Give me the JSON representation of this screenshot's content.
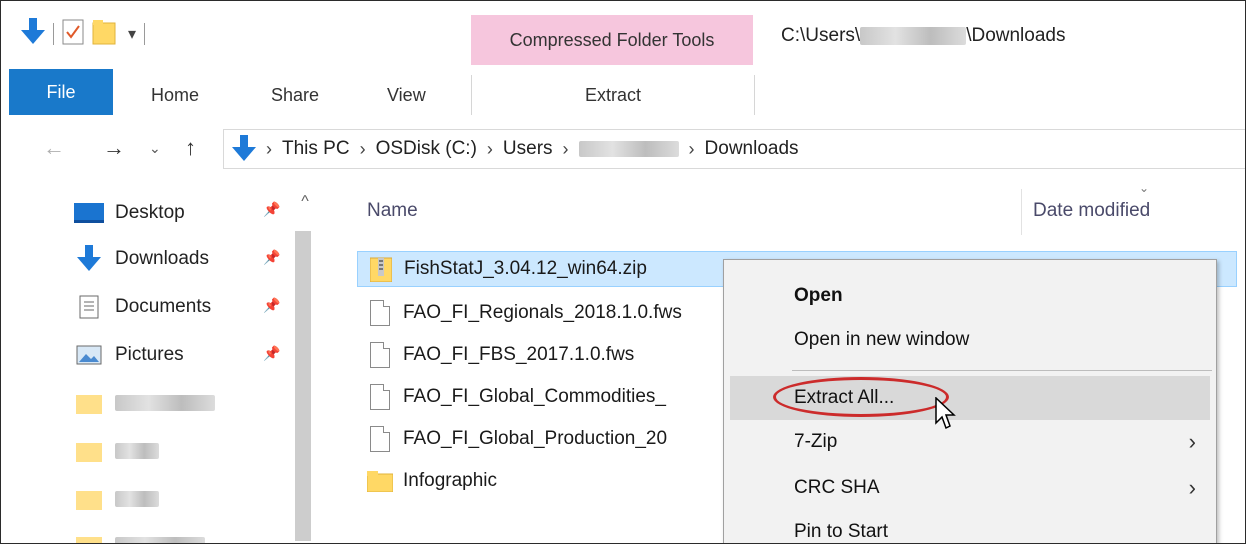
{
  "ribbon": {
    "context_group_label": "Compressed Folder Tools",
    "window_path": "C:\\Users\\",
    "window_path_suffix": "\\Downloads",
    "tabs": [
      "File",
      "Home",
      "Share",
      "View",
      "Extract"
    ]
  },
  "address": {
    "crumbs": [
      "This PC",
      "OSDisk (C:)",
      "Users",
      "Downloads"
    ]
  },
  "navpane": {
    "items": [
      {
        "label": "Desktop",
        "icon": "desktop-icon"
      },
      {
        "label": "Downloads",
        "icon": "download-arrow-icon"
      },
      {
        "label": "Documents",
        "icon": "documents-icon"
      },
      {
        "label": "Pictures",
        "icon": "pictures-icon"
      }
    ]
  },
  "filelist": {
    "columns": [
      "Name",
      "Date modified"
    ],
    "rows": [
      {
        "name": "FishStatJ_3.04.12_win64.zip",
        "icon": "zip-folder-icon"
      },
      {
        "name": "FAO_FI_Regionals_2018.1.0.fws",
        "icon": "file-icon"
      },
      {
        "name": "FAO_FI_FBS_2017.1.0.fws",
        "icon": "file-icon"
      },
      {
        "name": "FAO_FI_Global_Commodities_",
        "icon": "file-icon"
      },
      {
        "name": "FAO_FI_Global_Production_20",
        "icon": "file-icon"
      },
      {
        "name": "Infographic",
        "icon": "folder-icon"
      }
    ]
  },
  "context_menu": {
    "items": [
      {
        "label": "Open",
        "bold": true
      },
      {
        "label": "Open in new window"
      },
      {
        "label": "Extract All...",
        "highlighted": true
      },
      {
        "label": "7-Zip",
        "submenu": true
      },
      {
        "label": "CRC SHA",
        "submenu": true
      },
      {
        "label": "Pin to Start"
      }
    ]
  },
  "colors": {
    "file_tab": "#1979ca",
    "context_tab": "#f6c6dd",
    "selection": "#cce8ff",
    "annotation": "#cc2b2b"
  }
}
